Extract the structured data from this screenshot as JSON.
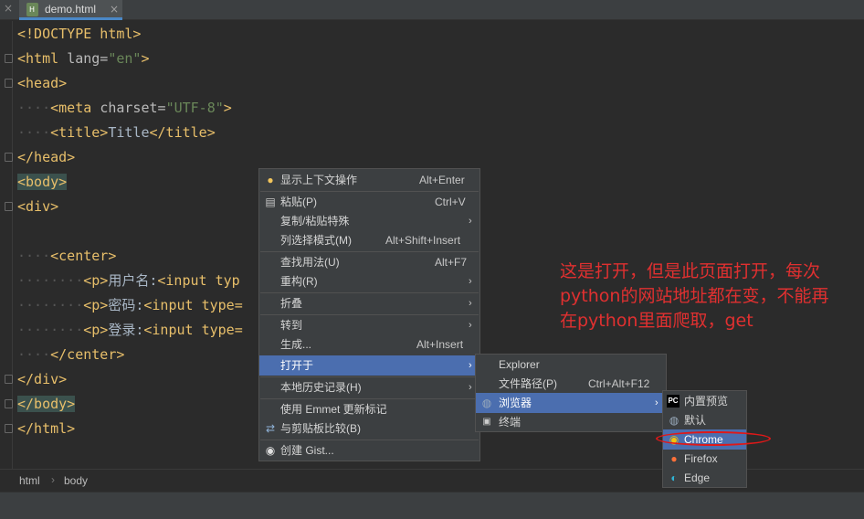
{
  "tab": {
    "close_left": "×",
    "filename": "demo.html",
    "close": "×"
  },
  "code": {
    "l1": "<!DOCTYPE html>",
    "l2_tag": "<html ",
    "l2_attr": "lang=",
    "l2_str": "\"en\"",
    "l2_end": ">",
    "l3": "<head>",
    "l4_dots": "····",
    "l4_tag": "<meta ",
    "l4_attr": "charset=",
    "l4_str": "\"UTF-8\"",
    "l4_end": ">",
    "l5_dots": "····",
    "l5_tag1": "<title>",
    "l5_txt": "Title",
    "l5_tag2": "</title>",
    "l6": "</head>",
    "l7": "<body>",
    "l8": "<div>",
    "l10_dots": "····",
    "l10": "<center>",
    "l11_dots": "········",
    "l11_tag": "<p>",
    "l11_txt": "用户名:",
    "l11_tag2": "<input typ",
    "l12_dots": "········",
    "l12_tag": "<p>",
    "l12_txt": "密码:",
    "l12_tag2": "<input type=",
    "l13_dots": "········",
    "l13_tag": "<p>",
    "l13_txt": "登录:",
    "l13_tag2": "<input type=",
    "l14_dots": "····",
    "l14": "</center>",
    "l15": "</div>",
    "l16": "</body>",
    "l17": "</html>"
  },
  "breadcrumb": {
    "item1": "html",
    "sep": "›",
    "item2": "body"
  },
  "context_menu": {
    "items": [
      {
        "label": "显示上下文操作",
        "shortcut": "Alt+Enter",
        "icon": "lightbulb-icon"
      },
      {
        "label": "粘贴(P)",
        "shortcut": "Ctrl+V",
        "icon": "clipboard-icon"
      },
      {
        "label": "复制/粘贴特殊",
        "arrow": "›"
      },
      {
        "label": "列选择模式(M)",
        "shortcut": "Alt+Shift+Insert"
      },
      {
        "label": "查找用法(U)",
        "shortcut": "Alt+F7"
      },
      {
        "label": "重构(R)",
        "arrow": "›"
      },
      {
        "label": "折叠",
        "arrow": "›"
      },
      {
        "label": "转到",
        "arrow": "›"
      },
      {
        "label": "生成...",
        "shortcut": "Alt+Insert"
      },
      {
        "label": "打开于",
        "arrow": "›"
      },
      {
        "label": "本地历史记录(H)",
        "arrow": "›"
      },
      {
        "label": "使用 Emmet 更新标记"
      },
      {
        "label": "与剪贴板比较(B)",
        "icon": "compare-icon"
      },
      {
        "label": "创建 Gist...",
        "icon": "github-icon"
      }
    ]
  },
  "open_in_menu": {
    "items": [
      {
        "label": "Explorer"
      },
      {
        "label": "文件路径(P)",
        "shortcut": "Ctrl+Alt+F12"
      },
      {
        "label": "浏览器",
        "arrow": "›",
        "icon": "globe-icon"
      },
      {
        "label": "终端",
        "icon": "terminal-icon"
      }
    ]
  },
  "browser_menu": {
    "items": [
      {
        "label": "内置预览",
        "icon": "pycharm-icon"
      },
      {
        "label": "默认",
        "icon": "globe-icon"
      },
      {
        "label": "Chrome",
        "icon": "chrome-icon"
      },
      {
        "label": "Firefox",
        "icon": "firefox-icon"
      },
      {
        "label": "Edge",
        "icon": "edge-icon"
      }
    ]
  },
  "annotation": {
    "line1": "这是打开，但是此页面打开，每次",
    "line2": "python的网站地址都在变，不能再",
    "line3": "在python里面爬取，get"
  },
  "colors": {
    "selection": "#4b6eaf",
    "annotation": "#e03030",
    "tag": "#e8bf6a",
    "string": "#6a8759"
  }
}
